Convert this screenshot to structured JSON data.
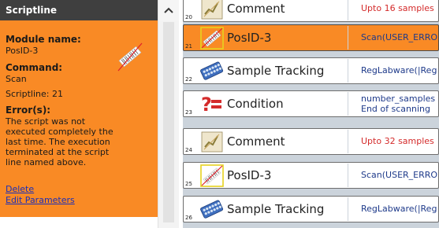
{
  "scriptline_panel": {
    "title": "Scriptline",
    "module_name_label": "Module name:",
    "module_name_value": "PosID-3",
    "command_label": "Command:",
    "command_value": "Scan",
    "scriptline_text": "Scriptline: 21",
    "errors_label": "Error(s):",
    "error_text": "The script was not executed completely the last time. The execution terminated at the script line named above.",
    "delete_link": "Delete",
    "edit_parameters_link": "Edit Parameters",
    "module_icon": "barcode-scanner-icon"
  },
  "scrollbar": {
    "up_arrow": "^"
  },
  "script_rows": [
    {
      "number": "20",
      "name": "Comment",
      "param": "Upto 16 samples",
      "param_line2": "",
      "icon": "comment-icon",
      "selected": false
    },
    {
      "number": "21",
      "name": "PosID-3",
      "param": "Scan(USER_ERRO",
      "param_line2": "",
      "icon": "barcode-scanner-icon",
      "selected": true
    },
    {
      "number": "22",
      "name": "Sample Tracking",
      "param": "RegLabware(|Reg",
      "param_line2": "",
      "icon": "rack-icon",
      "selected": false
    },
    {
      "number": "23",
      "name": "Condition",
      "param": "number_samples",
      "param_line2": "End of scanning",
      "icon": "condition-icon",
      "selected": false
    },
    {
      "number": "24",
      "name": "Comment",
      "param": "Upto 32 samples",
      "param_line2": "",
      "icon": "comment-icon",
      "selected": false
    },
    {
      "number": "25",
      "name": "PosID-3",
      "param": "Scan(USER_ERRO",
      "param_line2": "",
      "icon": "barcode-scanner-icon",
      "selected": false
    },
    {
      "number": "26",
      "name": "Sample Tracking",
      "param": "RegLabware(|Reg",
      "param_line2": "",
      "icon": "rack-icon",
      "selected": false
    }
  ],
  "colors": {
    "accent_orange": "#f98a25",
    "header_dark": "#3f3f3f",
    "link_blue": "#1b2fb8",
    "param_red": "#d42b2b",
    "param_blue": "#1e3a8a"
  }
}
